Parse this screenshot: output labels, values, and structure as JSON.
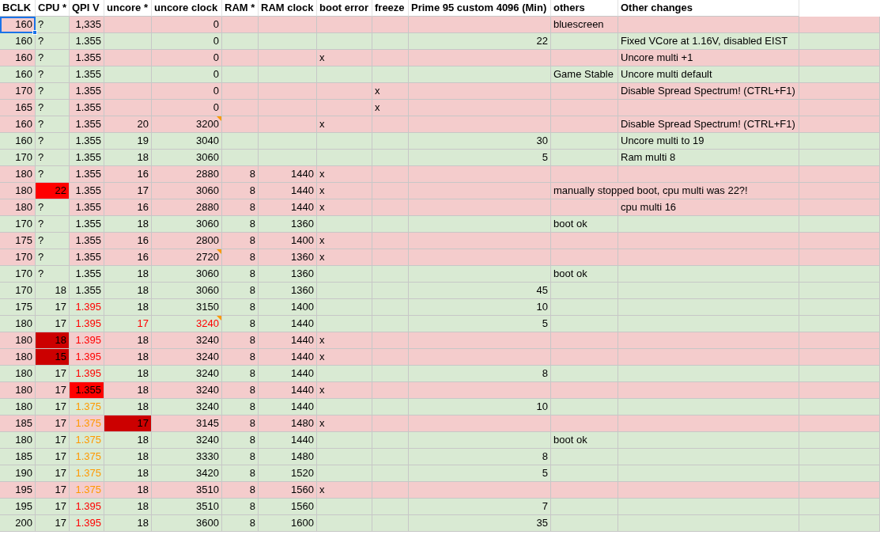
{
  "table": {
    "columns": [
      "BCLK",
      "CPU *",
      "QPI V",
      "uncore *",
      "uncore clock",
      "RAM *",
      "RAM clock",
      "boot error",
      "freeze",
      "Prime 95 custom 4096 (Min)",
      "others",
      "Other changes"
    ],
    "rows": [
      {
        "color": "#f4cccc",
        "cells": [
          {
            "text": "160",
            "selected": true
          },
          {
            "text": "?",
            "color": "#d9ead3"
          },
          "1,335",
          null,
          "0",
          null,
          null,
          null,
          null,
          null,
          "bluescreen",
          null
        ]
      },
      {
        "color": "#d9ead3",
        "cells": [
          "160",
          {
            "text": "?",
            "color": "#d9ead3"
          },
          "1.355",
          null,
          "0",
          null,
          null,
          null,
          null,
          "22",
          null,
          "Fixed VCore at 1.16V, disabled EIST"
        ]
      },
      {
        "color": "#f4cccc",
        "cells": [
          "160",
          {
            "text": "?",
            "color": "#d9ead3"
          },
          "1.355",
          null,
          "0",
          null,
          null,
          "x",
          null,
          null,
          null,
          "Uncore multi +1"
        ]
      },
      {
        "color": "#d9ead3",
        "cells": [
          "160",
          {
            "text": "?",
            "color": "#d9ead3"
          },
          "1.355",
          null,
          "0",
          null,
          null,
          null,
          null,
          null,
          "Game Stable",
          "Uncore multi default"
        ]
      },
      {
        "color": "#f4cccc",
        "cells": [
          "170",
          {
            "text": "?",
            "color": "#d9ead3"
          },
          "1.355",
          null,
          "0",
          null,
          null,
          null,
          "x",
          null,
          null,
          "Disable Spread Spectrum! (CTRL+F1)"
        ]
      },
      {
        "color": "#f4cccc",
        "cells": [
          "165",
          {
            "text": "?",
            "color": "#d9ead3"
          },
          "1.355",
          null,
          "0",
          null,
          null,
          null,
          "x",
          null,
          null,
          null
        ]
      },
      {
        "color": "#f4cccc",
        "cells": [
          "160",
          {
            "text": "?",
            "color": "#d9ead3"
          },
          "1.355",
          "20",
          {
            "text": "3200",
            "note": true
          },
          null,
          null,
          "x",
          null,
          null,
          null,
          "Disable Spread Spectrum! (CTRL+F1)"
        ]
      },
      {
        "color": "#d9ead3",
        "cells": [
          "160",
          {
            "text": "?",
            "color": "#d9ead3"
          },
          "1.355",
          "19",
          "3040",
          null,
          null,
          null,
          null,
          "30",
          null,
          "Uncore multi to 19"
        ]
      },
      {
        "color": "#d9ead3",
        "cells": [
          "170",
          {
            "text": "?",
            "color": "#d9ead3"
          },
          "1.355",
          "18",
          "3060",
          null,
          null,
          null,
          null,
          "5",
          null,
          "Ram multi 8"
        ]
      },
      {
        "color": "#f4cccc",
        "cells": [
          "180",
          {
            "text": "?",
            "color": "#d9ead3"
          },
          "1.355",
          "16",
          "2880",
          "8",
          "1440",
          "x",
          null,
          null,
          null,
          null
        ]
      },
      {
        "color": "#f4cccc",
        "cells": [
          "180",
          {
            "text": "22",
            "color": "#ff0000"
          },
          "1.355",
          "17",
          "3060",
          "8",
          "1440",
          "x",
          null,
          null,
          "manually stopped boot, cpu multi was 22?!",
          null
        ]
      },
      {
        "color": "#f4cccc",
        "cells": [
          "180",
          {
            "text": "?",
            "color": "#d9ead3"
          },
          "1.355",
          "16",
          "2880",
          "8",
          "1440",
          "x",
          null,
          null,
          null,
          "cpu multi 16"
        ]
      },
      {
        "color": "#d9ead3",
        "cells": [
          "170",
          {
            "text": "?",
            "color": "#d9ead3"
          },
          "1.355",
          "18",
          "3060",
          "8",
          "1360",
          null,
          null,
          null,
          "boot ok",
          null
        ]
      },
      {
        "color": "#f4cccc",
        "cells": [
          "175",
          {
            "text": "?",
            "color": "#d9ead3"
          },
          "1.355",
          "16",
          "2800",
          "8",
          "1400",
          "x",
          null,
          null,
          null,
          null
        ]
      },
      {
        "color": "#f4cccc",
        "cells": [
          "170",
          {
            "text": "?",
            "color": "#d9ead3"
          },
          "1.355",
          "16",
          {
            "text": "2720",
            "note": true
          },
          "8",
          "1360",
          "x",
          null,
          null,
          null,
          null
        ]
      },
      {
        "color": "#d9ead3",
        "cells": [
          "170",
          {
            "text": "?",
            "color": "#d9ead3"
          },
          "1.355",
          "18",
          "3060",
          "8",
          "1360",
          null,
          null,
          null,
          "boot ok",
          null
        ]
      },
      {
        "color": "#d9ead3",
        "cells": [
          "170",
          "18",
          "1.355",
          "18",
          "3060",
          "8",
          "1360",
          null,
          null,
          "45",
          null,
          null
        ]
      },
      {
        "color": "#d9ead3",
        "cells": [
          "175",
          "17",
          {
            "text": "1.395",
            "font": {
              "color": "#ff0000"
            }
          },
          "18",
          "3150",
          "8",
          "1400",
          null,
          null,
          "10",
          null,
          null
        ]
      },
      {
        "color": "#d9ead3",
        "cells": [
          "180",
          "17",
          {
            "text": "1.395",
            "font": {
              "color": "#ff0000"
            }
          },
          {
            "text": "17",
            "font": {
              "color": "#ff0000"
            }
          },
          {
            "text": "3240",
            "font": {
              "color": "#ff0000"
            },
            "note": true
          },
          "8",
          "1440",
          null,
          null,
          "5",
          null,
          null
        ]
      },
      {
        "color": "#f4cccc",
        "cells": [
          "180",
          {
            "text": "18",
            "color": "#cc0000"
          },
          {
            "text": "1.395",
            "font": {
              "color": "#ff0000"
            }
          },
          "18",
          "3240",
          "8",
          "1440",
          "x",
          null,
          null,
          null,
          null
        ]
      },
      {
        "color": "#f4cccc",
        "cells": [
          "180",
          {
            "text": "15",
            "color": "#cc0000"
          },
          {
            "text": "1.395",
            "font": {
              "color": "#ff0000"
            }
          },
          "18",
          "3240",
          "8",
          "1440",
          "x",
          null,
          null,
          null,
          null
        ]
      },
      {
        "color": "#d9ead3",
        "cells": [
          "180",
          "17",
          {
            "text": "1.395",
            "font": {
              "color": "#ff0000"
            }
          },
          "18",
          "3240",
          "8",
          "1440",
          null,
          null,
          "8",
          null,
          null
        ]
      },
      {
        "color": "#f4cccc",
        "cells": [
          "180",
          "17",
          {
            "text": "1.355",
            "color": "#ff0000"
          },
          "18",
          "3240",
          "8",
          "1440",
          "x",
          null,
          null,
          null,
          null
        ]
      },
      {
        "color": "#d9ead3",
        "cells": [
          "180",
          "17",
          {
            "text": "1.375",
            "font": {
              "color": "#ff9900"
            }
          },
          "18",
          "3240",
          "8",
          "1440",
          null,
          null,
          "10",
          null,
          null
        ]
      },
      {
        "color": "#f4cccc",
        "cells": [
          "185",
          "17",
          {
            "text": "1.375",
            "font": {
              "color": "#ff9900"
            }
          },
          {
            "text": "17",
            "color": "#cc0000"
          },
          "3145",
          "8",
          "1480",
          "x",
          null,
          null,
          null,
          null
        ]
      },
      {
        "color": "#d9ead3",
        "cells": [
          "180",
          "17",
          {
            "text": "1.375",
            "font": {
              "color": "#ff9900"
            }
          },
          "18",
          "3240",
          "8",
          "1440",
          null,
          null,
          null,
          "boot ok",
          null
        ]
      },
      {
        "color": "#d9ead3",
        "cells": [
          "185",
          "17",
          {
            "text": "1.375",
            "font": {
              "color": "#ff9900"
            }
          },
          "18",
          "3330",
          "8",
          "1480",
          null,
          null,
          "8",
          null,
          null
        ]
      },
      {
        "color": "#d9ead3",
        "cells": [
          "190",
          "17",
          {
            "text": "1.375",
            "font": {
              "color": "#ff9900"
            }
          },
          "18",
          "3420",
          "8",
          "1520",
          null,
          null,
          "5",
          null,
          null
        ]
      },
      {
        "color": "#f4cccc",
        "cells": [
          "195",
          "17",
          {
            "text": "1.375",
            "font": {
              "color": "#ff9900"
            }
          },
          "18",
          "3510",
          "8",
          "1560",
          "x",
          null,
          null,
          null,
          null
        ]
      },
      {
        "color": "#d9ead3",
        "cells": [
          "195",
          "17",
          {
            "text": "1.395",
            "font": {
              "color": "#ff0000"
            }
          },
          "18",
          "3510",
          "8",
          "1560",
          null,
          null,
          "7",
          null,
          null
        ]
      },
      {
        "color": "#d9ead3",
        "cells": [
          "200",
          "17",
          {
            "text": "1.395",
            "font": {
              "color": "#ff0000"
            }
          },
          "18",
          "3600",
          "8",
          "1600",
          null,
          null,
          "35",
          null,
          null
        ]
      }
    ]
  }
}
